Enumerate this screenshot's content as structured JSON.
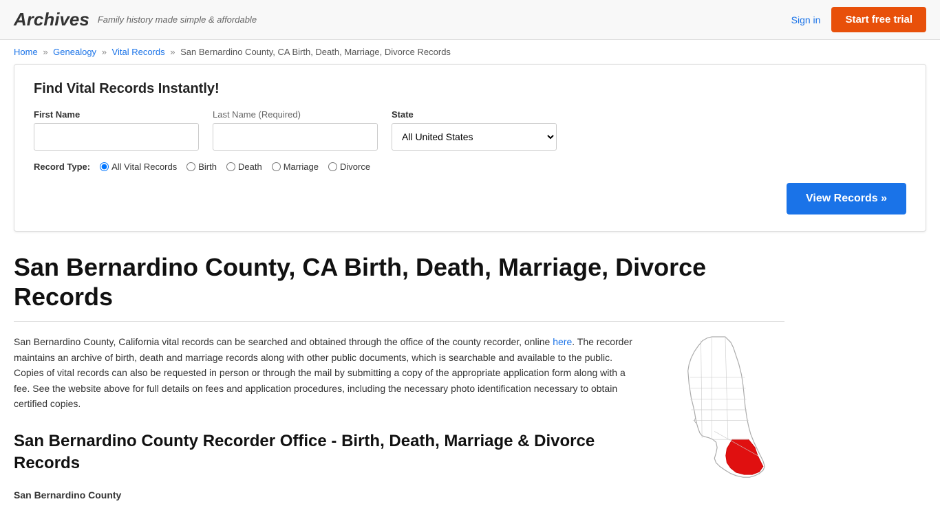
{
  "header": {
    "logo": "Archives",
    "tagline": "Family history made simple & affordable",
    "signin_label": "Sign in",
    "trial_btn_label": "Start free trial"
  },
  "breadcrumb": {
    "home": "Home",
    "genealogy": "Genealogy",
    "vital_records": "Vital Records",
    "current": "San Bernardino County, CA Birth, Death, Marriage, Divorce Records"
  },
  "search": {
    "title": "Find Vital Records Instantly!",
    "first_name_label": "First Name",
    "last_name_label": "Last Name",
    "last_name_required": "(Required)",
    "state_label": "State",
    "state_default": "All United States",
    "record_type_label": "Record Type:",
    "record_types": [
      {
        "id": "all",
        "label": "All Vital Records",
        "checked": true
      },
      {
        "id": "birth",
        "label": "Birth",
        "checked": false
      },
      {
        "id": "death",
        "label": "Death",
        "checked": false
      },
      {
        "id": "marriage",
        "label": "Marriage",
        "checked": false
      },
      {
        "id": "divorce",
        "label": "Divorce",
        "checked": false
      }
    ],
    "view_records_btn": "View Records »"
  },
  "page": {
    "title": "San Bernardino County, CA Birth, Death, Marriage, Divorce Records",
    "body_text_1": "San Bernardino County, California vital records can be searched and obtained through the office of the county recorder, online ",
    "body_link_text": "here",
    "body_text_2": ". The recorder maintains an archive of birth, death and marriage records along with other public documents, which is searchable and available to the public. Copies of vital records can also be requested in person or through the mail by submitting a copy of the appropriate application form along with a fee. See the website above for full details on fees and application procedures, including the necessary photo identification necessary to obtain certified copies.",
    "section_title": "San Bernardino County Recorder Office - Birth, Death, Marriage & Divorce Records",
    "county_name": "San Bernardino County"
  }
}
